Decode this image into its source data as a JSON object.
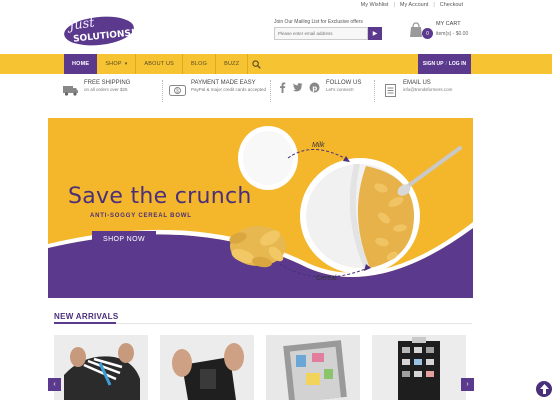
{
  "toplinks": [
    "My Wishlist",
    "My Account",
    "Checkout"
  ],
  "logo": {
    "line1": "Just",
    "line2": "SOLUTIONS!"
  },
  "mailing": {
    "label": "Join Our Mailing List for Exclusive offers",
    "placeholder": "Please enter email address"
  },
  "cart": {
    "title": "MY CART",
    "count": "0",
    "summary": "item(s) - $0.00"
  },
  "nav": {
    "items": [
      "HOME",
      "SHOP",
      "ABOUT US",
      "BLOG",
      "BUZZ"
    ],
    "signup": "SIGN UP",
    "login": "LOG IN"
  },
  "features": {
    "shipping": {
      "title": "FREE SHIPPING",
      "sub": "on all orders over $25"
    },
    "payment": {
      "title": "PAYMENT MADE EASY",
      "sub": "PayPal & major credit cards accepted"
    },
    "follow": {
      "title": "FOLLOW US",
      "sub": "Let's connect!"
    },
    "email": {
      "title": "EMAIL US",
      "sub": "info@trendsformers.com"
    }
  },
  "hero": {
    "headline": "Save the crunch",
    "tagline": "ANTI-SOGGY CEREAL BOWL",
    "button": "SHOP NOW",
    "label_milk": "Milk",
    "label_cereal": "Cereal"
  },
  "arrivals": {
    "title": "NEW ARRIVALS"
  },
  "colors": {
    "purple": "#5b3a8e",
    "yellow": "#f6c333"
  },
  "icons": [
    "truck-icon",
    "money-icon",
    "facebook-icon",
    "twitter-icon",
    "pinterest-icon",
    "document-icon",
    "cart-icon",
    "search-icon",
    "envelope-arrow-icon",
    "arrow-up-icon"
  ]
}
